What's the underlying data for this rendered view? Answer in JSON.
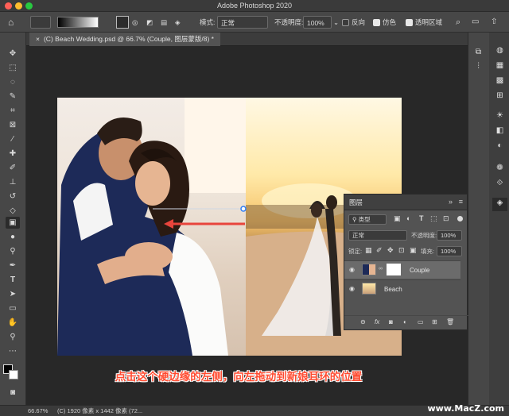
{
  "app": {
    "title": "Adobe Photoshop 2020"
  },
  "options_bar": {
    "mode_label": "模式:",
    "mode_value": "正常",
    "opacity_label": "不透明度:",
    "opacity_value": "100%",
    "reverse_label": "反向",
    "dither_label": "仿色",
    "transparency_label": "透明区域"
  },
  "document": {
    "tab_title": "(C) Beach Wedding.psd @ 66.7% (Couple, 图层蒙版/8) *"
  },
  "layers_panel": {
    "title": "图层",
    "filter_label": "类型",
    "blend_mode": "正常",
    "opacity_label": "不透明度:",
    "opacity_value": "100%",
    "lock_label": "锁定:",
    "fill_label": "填充:",
    "fill_value": "100%",
    "layers": [
      {
        "name": "Couple"
      },
      {
        "name": "Beach"
      }
    ]
  },
  "status": {
    "zoom": "66.67%",
    "doc_info": "(C) 1920 像素 x 1442 像素 (72..."
  },
  "caption": "点击这个硬边缘的左侧，向左拖动到新娘耳环的位置",
  "watermark": "www.MacZ.com",
  "colors": {
    "caption": "#ff4b30",
    "accent_blue": "#2e7df6",
    "arrow": "#e8453c"
  },
  "icons": {
    "tools": [
      "move-icon",
      "marquee-icon",
      "lasso-icon",
      "quick-select-icon",
      "crop-icon",
      "frame-icon",
      "eyedropper-icon",
      "healing-icon",
      "brush-icon",
      "stamp-icon",
      "history-brush-icon",
      "eraser-icon",
      "gradient-icon",
      "blur-icon",
      "dodge-icon",
      "pen-icon",
      "type-icon",
      "path-select-icon",
      "shape-icon",
      "hand-icon",
      "zoom-icon",
      "more-tools-icon"
    ]
  }
}
